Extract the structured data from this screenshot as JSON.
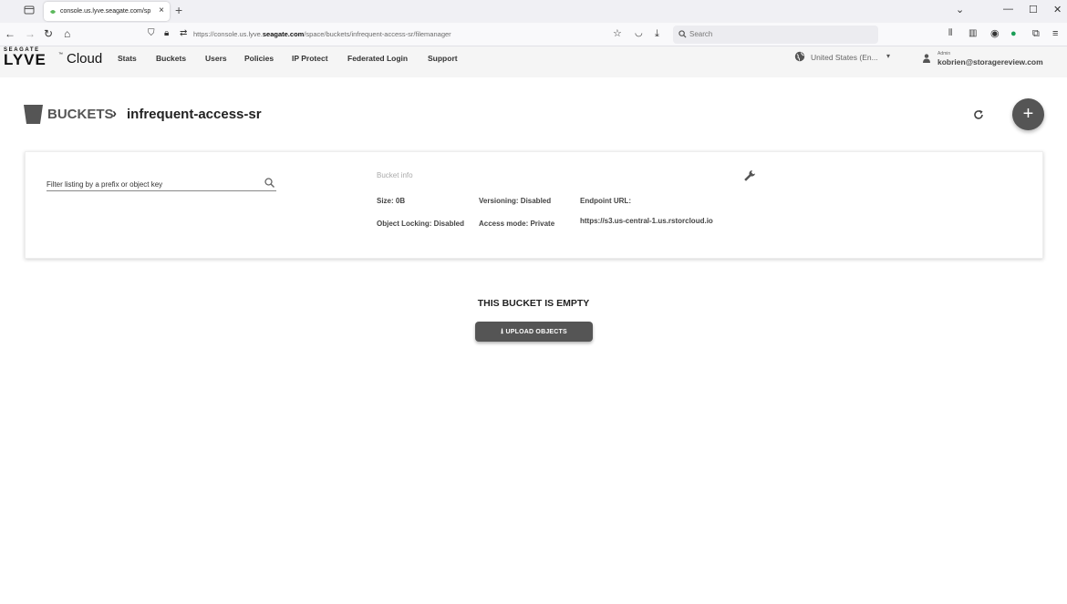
{
  "browser": {
    "tab_title": "console.us.lyve.seagate.com/sp",
    "url_prefix": "https://console.us.lyve.",
    "url_domain": "seagate.com",
    "url_path": "/space/buckets/infrequent-access-sr/filemanager",
    "search_placeholder": "Search"
  },
  "brand": {
    "top": "SEAGATE",
    "main": "LYVE",
    "tm": "™",
    "cloud": "Cloud"
  },
  "nav": {
    "items": [
      "Stats",
      "Buckets",
      "Users",
      "Policies",
      "IP Protect",
      "Federated Login",
      "Support"
    ],
    "region": "United States (En...",
    "role": "Admin",
    "user": "kobrien@storagereview.com"
  },
  "breadcrumb": {
    "root": "BUCKETS",
    "sep": "›",
    "current": "infrequent-access-sr"
  },
  "filter": {
    "placeholder": "Filter listing by a prefix or object key"
  },
  "bucket_info": {
    "title": "Bucket info",
    "size": "Size: 0B",
    "versioning": "Versioning: Disabled",
    "endpoint_label": "Endpoint URL:",
    "object_locking": "Object Locking: Disabled",
    "access_mode": "Access mode: Private",
    "endpoint_url": "https://s3.us-central-1.us.rstorcloud.io"
  },
  "empty_state": {
    "message": "THIS BUCKET IS EMPTY",
    "upload_label": "UPLOAD OBJECTS"
  },
  "colors": {
    "accent_dark": "#555555",
    "header_bg": "#f5f5f5"
  }
}
